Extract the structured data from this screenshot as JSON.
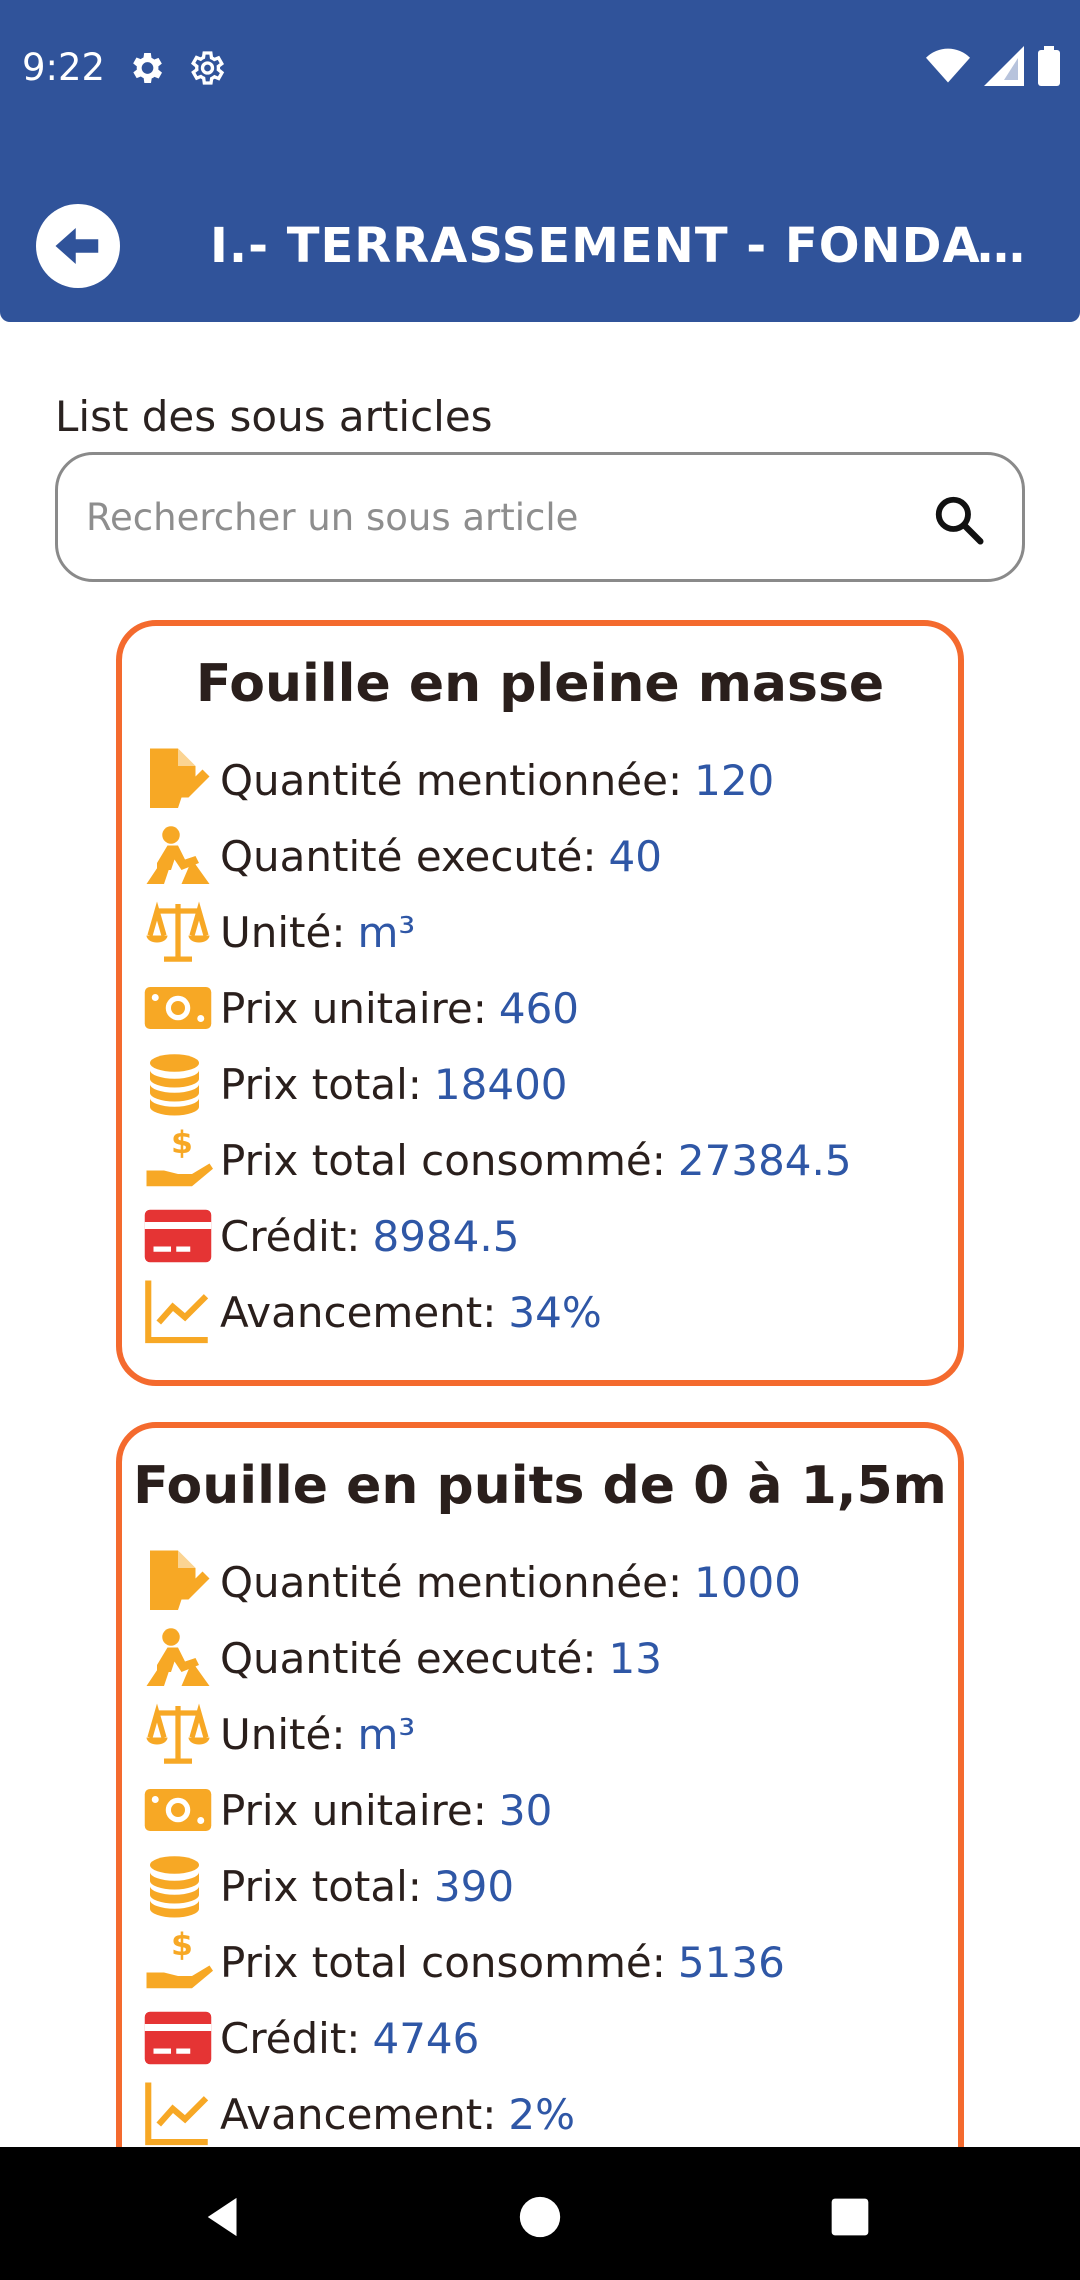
{
  "status_bar": {
    "time": "9:22"
  },
  "header": {
    "title": "I.- TERRASSEMENT - FONDATIONS"
  },
  "search": {
    "label": "List des sous articles",
    "placeholder": "Rechercher un sous article",
    "value": ""
  },
  "cards": [
    {
      "title": "Fouille en pleine masse",
      "rows": [
        {
          "label": "Quantité mentionnée:",
          "value": "120"
        },
        {
          "label": "Quantité executé:",
          "value": "40"
        },
        {
          "label": "Unité:",
          "value": "m³"
        },
        {
          "label": "Prix unitaire:",
          "value": "460"
        },
        {
          "label": "Prix total:",
          "value": "18400"
        },
        {
          "label": "Prix total consommé:",
          "value": "27384.5"
        },
        {
          "label": "Crédit:",
          "value": "8984.5"
        },
        {
          "label": "Avancement:",
          "value": "34%"
        }
      ]
    },
    {
      "title": "Fouille en puits de 0 à 1,5m",
      "rows": [
        {
          "label": "Quantité mentionnée:",
          "value": "1000"
        },
        {
          "label": "Quantité executé:",
          "value": "13"
        },
        {
          "label": "Unité:",
          "value": "m³"
        },
        {
          "label": "Prix unitaire:",
          "value": "30"
        },
        {
          "label": "Prix total:",
          "value": "390"
        },
        {
          "label": "Prix total consommé:",
          "value": "5136"
        },
        {
          "label": "Crédit:",
          "value": "4746"
        },
        {
          "label": "Avancement:",
          "value": "2%"
        }
      ]
    }
  ],
  "colors": {
    "header": "#30539a",
    "accent_border": "#f46a2e",
    "icon": "#f7a825",
    "value": "#2f57a6",
    "credit_icon": "#e53434"
  },
  "icons": [
    "document-edit-icon",
    "worker-digging-icon",
    "scale-icon",
    "banknote-icon",
    "coins-icon",
    "hand-dollar-icon",
    "credit-card-icon",
    "chart-line-icon"
  ]
}
